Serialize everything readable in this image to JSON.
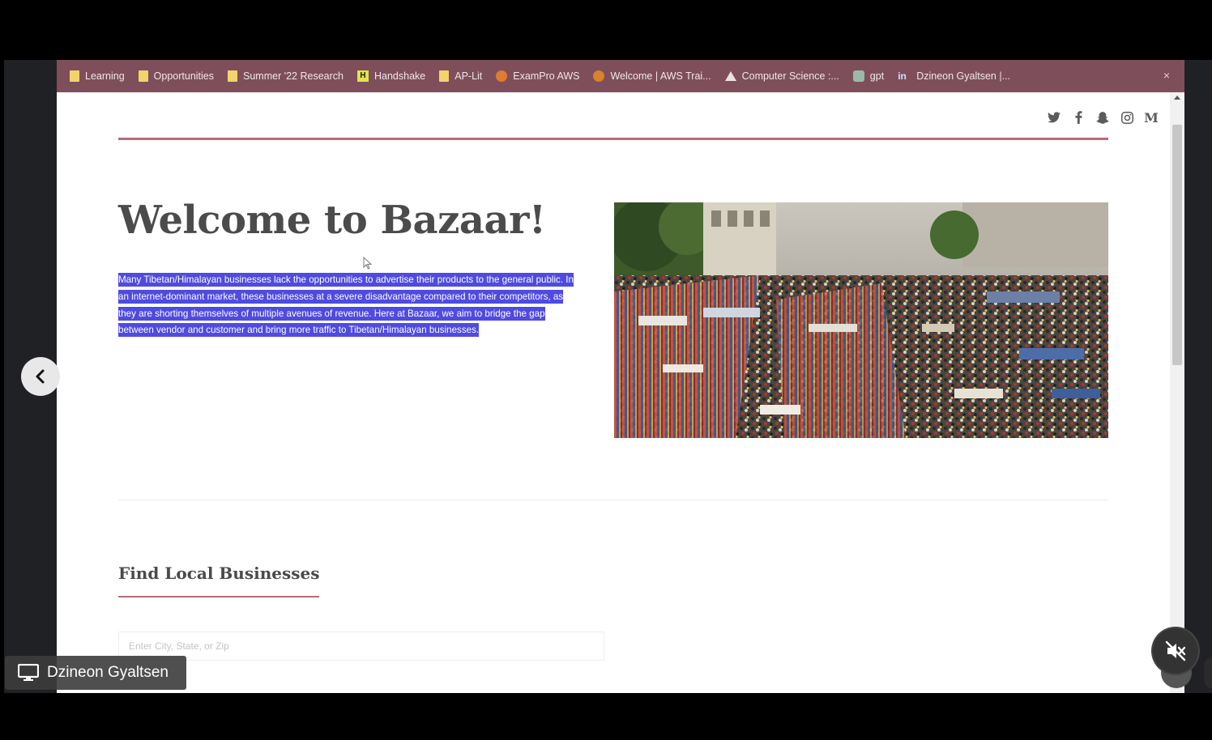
{
  "bookmarks": [
    {
      "label": "Learning",
      "icon": "folder-icon"
    },
    {
      "label": "Opportunities",
      "icon": "folder-icon"
    },
    {
      "label": "Summer '22 Research",
      "icon": "folder-icon"
    },
    {
      "label": "Handshake",
      "icon": "handshake-icon"
    },
    {
      "label": "AP-Lit",
      "icon": "folder-icon"
    },
    {
      "label": "ExamPro AWS",
      "icon": "exampro-icon"
    },
    {
      "label": "Welcome | AWS Trai...",
      "icon": "aws-icon"
    },
    {
      "label": "Computer Science :...",
      "icon": "drive-icon"
    },
    {
      "label": "gpt",
      "icon": "gpt-icon"
    },
    {
      "label": "Dzineon Gyaltsen |...",
      "icon": "linkedin-icon"
    }
  ],
  "bookmark_close": "×",
  "social_icons": [
    "twitter-icon",
    "facebook-icon",
    "snapchat-icon",
    "instagram-icon",
    "medium-icon"
  ],
  "hero": {
    "title": "Welcome to Bazaar!",
    "description": "Many Tibetan/Himalayan businesses lack the opportunities to advertise their products to the general public. In an internet-dominant market, these businesses at a severe disadvantage compared to their competitors, as they are shorting themselves of multiple avenues of revenue. Here at Bazaar, we aim to bridge the gap between vendor and customer and bring more traffic to Tibetan/Himalayan businesses."
  },
  "find": {
    "title": "Find Local Businesses",
    "search_placeholder": "Enter City, State, or Zip"
  },
  "meeting": {
    "presenter_name": "Dzineon Gyaltsen"
  },
  "colors": {
    "bookmark_bar": "#7e4f5a",
    "accent_line": "#b46c78",
    "selection": "#4f4be0"
  }
}
